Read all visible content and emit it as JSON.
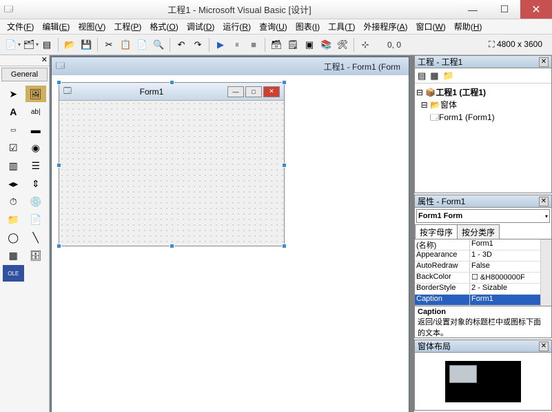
{
  "titlebar": {
    "title": "工程1 - Microsoft Visual Basic [设计]"
  },
  "menu": [
    {
      "label": "文件(F)",
      "u": "F"
    },
    {
      "label": "编辑(E)",
      "u": "E"
    },
    {
      "label": "视图(V)",
      "u": "V"
    },
    {
      "label": "工程(P)",
      "u": "P"
    },
    {
      "label": "格式(O)",
      "u": "O"
    },
    {
      "label": "调试(D)",
      "u": "D"
    },
    {
      "label": "运行(R)",
      "u": "R"
    },
    {
      "label": "查询(U)",
      "u": "U"
    },
    {
      "label": "图表(I)",
      "u": "I"
    },
    {
      "label": "工具(T)",
      "u": "T"
    },
    {
      "label": "外接程序(A)",
      "u": "A"
    },
    {
      "label": "窗口(W)",
      "u": "W"
    },
    {
      "label": "帮助(H)",
      "u": "H"
    }
  ],
  "toolbar": {
    "coord_label": "0, 0",
    "size_label": "4800 x 3600"
  },
  "toolbox": {
    "tab": "General"
  },
  "mdi": {
    "child_title": "工程1 - Form1 (Form",
    "form_caption": "Form1"
  },
  "project": {
    "title": "工程 - 工程1",
    "root": "工程1 (工程1)",
    "folder": "窗体",
    "item": "Form1 (Form1)"
  },
  "props": {
    "title": "属性 - Form1",
    "selector": "Form1 Form",
    "tab_alpha": "按字母序",
    "tab_cat": "按分类序",
    "rows": [
      {
        "n": "(名称)",
        "v": "Form1",
        "sel": false
      },
      {
        "n": "Appearance",
        "v": "1 - 3D",
        "sel": false
      },
      {
        "n": "AutoRedraw",
        "v": "False",
        "sel": false
      },
      {
        "n": "BackColor",
        "v": "☐ &H8000000F",
        "sel": false
      },
      {
        "n": "BorderStyle",
        "v": "2 - Sizable",
        "sel": false
      },
      {
        "n": "Caption",
        "v": "Form1",
        "sel": true
      }
    ],
    "desc_name": "Caption",
    "desc_text": "返回/设置对象的标题栏中或图标下面的文本。"
  },
  "layout": {
    "title": "窗体布局"
  }
}
